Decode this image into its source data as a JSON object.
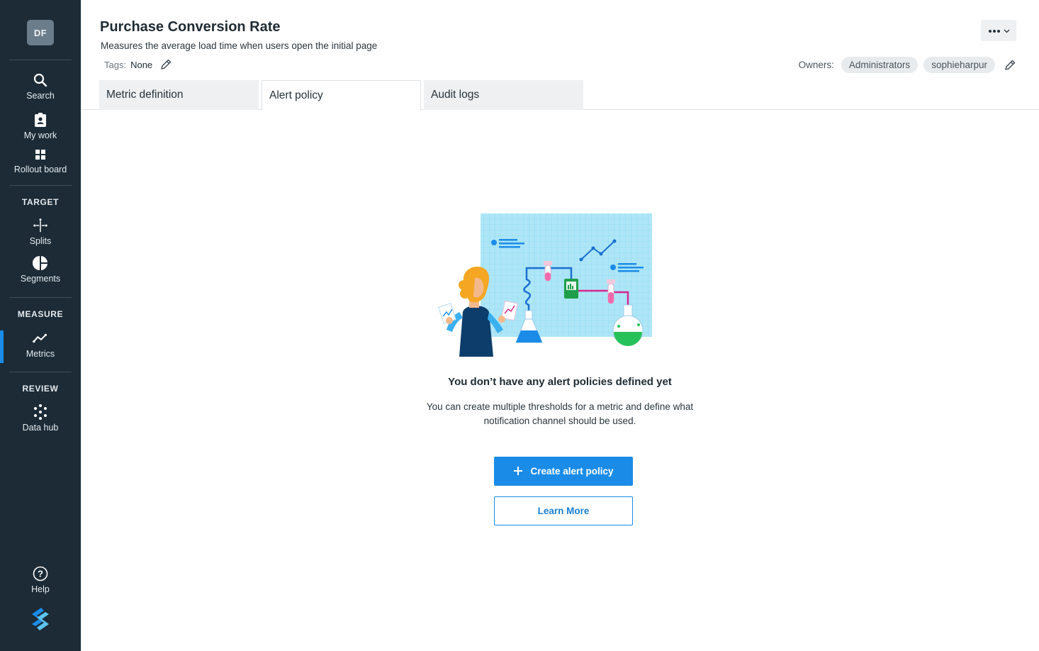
{
  "sidebar": {
    "avatar_initials": "DF",
    "items": [
      {
        "label": "Search",
        "icon": "search-icon"
      },
      {
        "label": "My work",
        "icon": "clipboard-icon"
      },
      {
        "label": "Rollout board",
        "icon": "grid-icon"
      },
      {
        "label": "Splits",
        "icon": "split-icon"
      },
      {
        "label": "Segments",
        "icon": "segments-icon"
      },
      {
        "label": "Metrics",
        "icon": "metrics-icon"
      },
      {
        "label": "Data hub",
        "icon": "data-hub-icon"
      },
      {
        "label": "Help",
        "icon": "help-icon"
      }
    ],
    "sections": {
      "target": "TARGET",
      "measure": "MEASURE",
      "review": "REVIEW"
    },
    "active_item": "Metrics",
    "accent_color": "#1a8ce8",
    "background_color": "#1c2b36"
  },
  "header": {
    "title": "Purchase Conversion Rate",
    "subtitle": "Measures the average load time when users open the initial page",
    "tags_label": "Tags:",
    "tags_value": "None",
    "owners_label": "Owners:",
    "owners": [
      "Administrators",
      "sophieharpur"
    ]
  },
  "tabs": [
    {
      "label": "Metric definition",
      "active": false
    },
    {
      "label": "Alert policy",
      "active": true
    },
    {
      "label": "Audit logs",
      "active": false
    }
  ],
  "empty_state": {
    "title": "You don’t have any alert policies defined yet",
    "description_line1": "You can create multiple thresholds for a metric and define what",
    "description_line2": "notification channel should be used.",
    "primary_button": "Create alert policy",
    "secondary_button": "Learn More"
  }
}
